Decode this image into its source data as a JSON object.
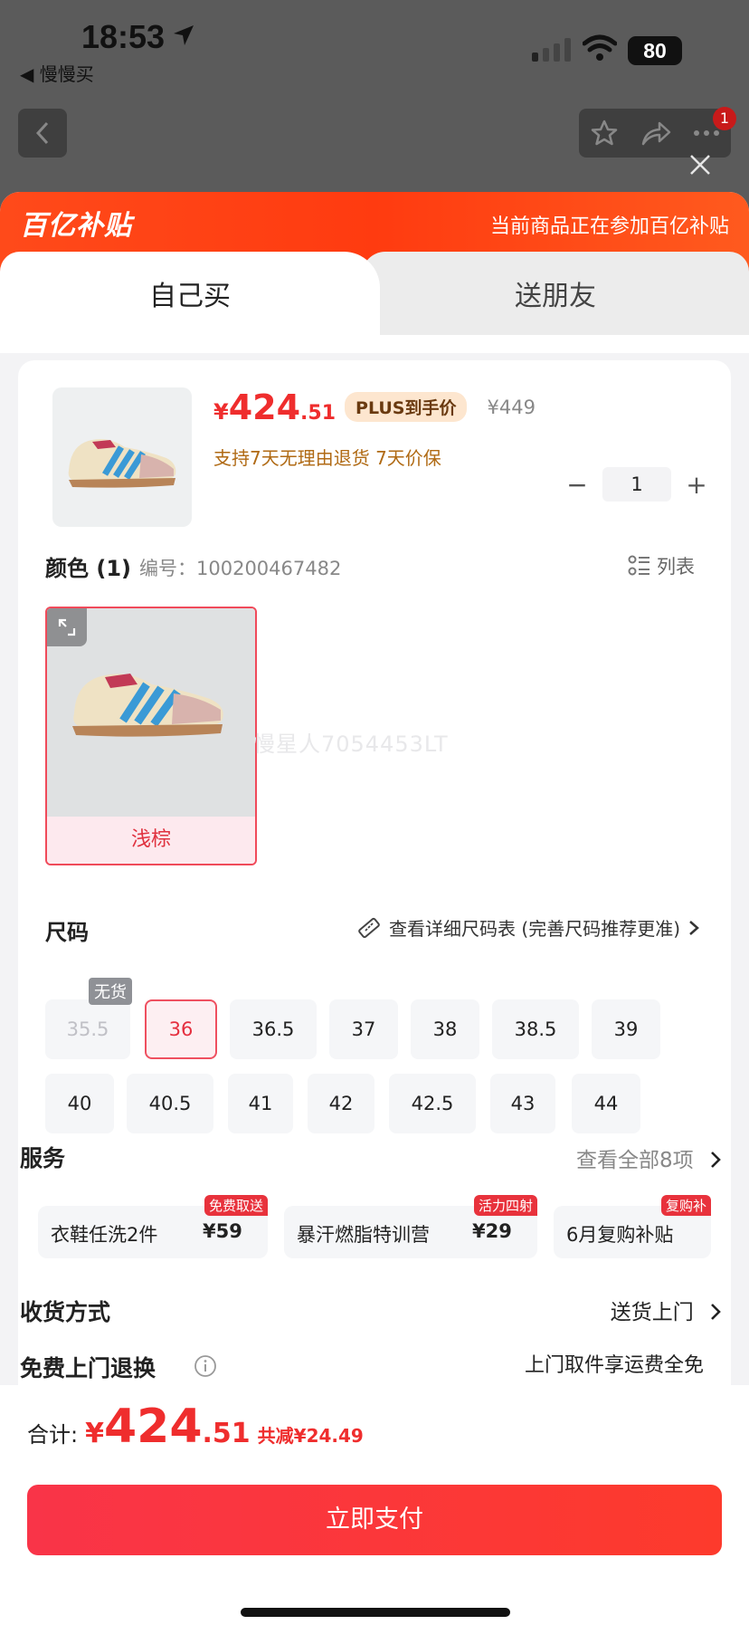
{
  "status_bar": {
    "time": "18:53",
    "back_app": "◀ 慢慢买",
    "battery": "80"
  },
  "top_nav": {
    "badge": "1"
  },
  "banner": {
    "brand": "百亿补贴",
    "note": "当前商品正在参加百亿补贴"
  },
  "tabs": {
    "self": "自己买",
    "gift": "送朋友"
  },
  "product": {
    "price_symbol": "¥",
    "price_int": "424",
    "price_dec": ".51",
    "plus_tag": "PLUS到手价",
    "original_price": "¥449",
    "promise": "支持7天无理由退货   7天价保",
    "quantity": "1",
    "qty_minus": "−",
    "qty_plus": "+"
  },
  "color_section": {
    "title": "颜色 (1)",
    "sku": "编号：100200467482",
    "list_toggle": "列表",
    "option": "浅棕"
  },
  "watermark": "慢星人7054453LT",
  "size_section": {
    "title": "尺码",
    "chart_link": "查看详细尺码表 (完善尺码推荐更准)",
    "out_of_stock": "无货",
    "sizes": [
      "35.5",
      "36",
      "36.5",
      "37",
      "38",
      "38.5",
      "39",
      "40",
      "40.5",
      "41",
      "42",
      "42.5",
      "43",
      "44"
    ]
  },
  "service": {
    "title": "服务",
    "view_all": "查看全部8项",
    "items": [
      {
        "name": "衣鞋任洗2件",
        "price": "¥59",
        "tag": "免费取送"
      },
      {
        "name": "暴汗燃脂特训营",
        "price": "¥29",
        "tag": "活力四射"
      },
      {
        "name": "6月复购补贴",
        "price": "",
        "tag": "复购补"
      }
    ]
  },
  "shipping": {
    "title": "收货方式",
    "value": "送货上门"
  },
  "returns": {
    "title": "免费上门退换",
    "value": "上门取件享运费全免"
  },
  "footer": {
    "total_label": "合计:",
    "total_symbol": "¥",
    "total_int": "424",
    "total_dec": ".51",
    "discount": "共减¥24.49",
    "pay_button": "立即支付"
  },
  "colors": {
    "accent": "#EF2D2D",
    "banner": "#FF4A1A",
    "promise": "#B06A14"
  }
}
